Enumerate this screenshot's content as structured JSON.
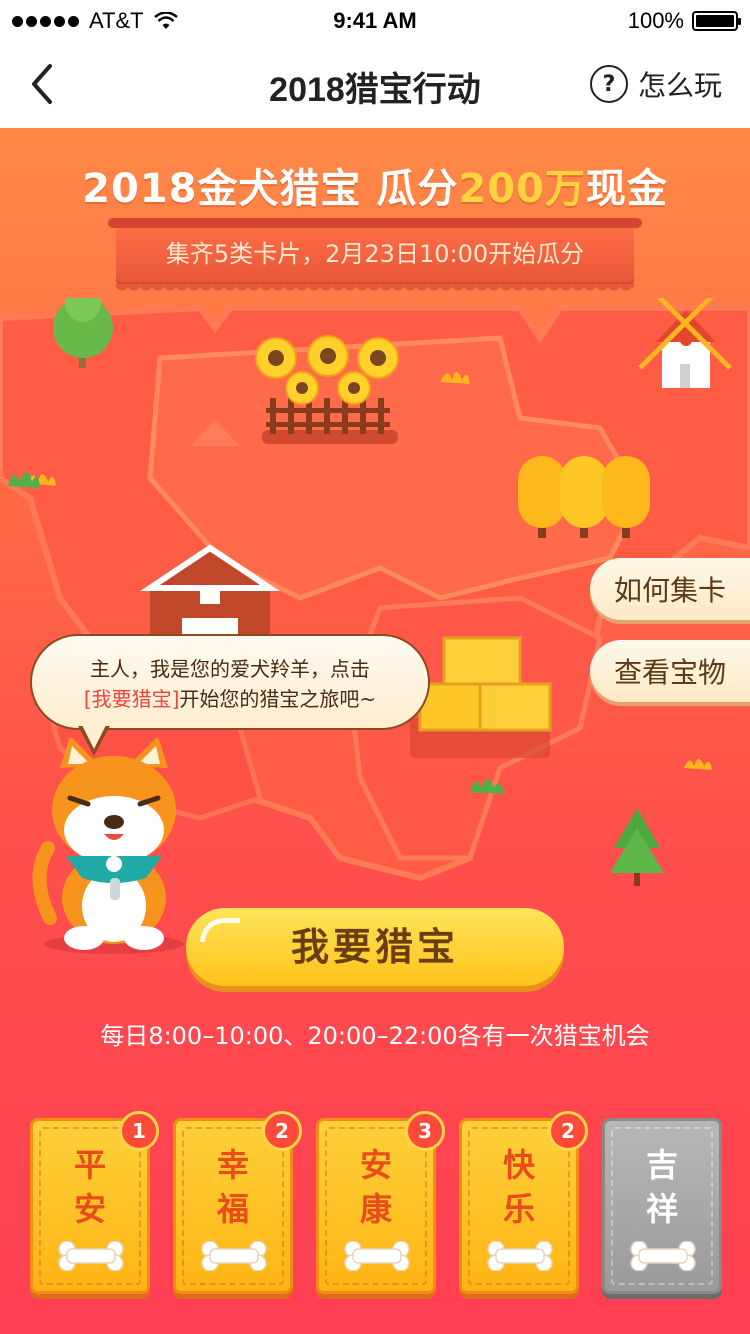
{
  "status_bar": {
    "carrier": "AT&T",
    "time": "9:41 AM",
    "battery": "100%"
  },
  "nav": {
    "title": "2018猎宝行动",
    "help_label": "怎么玩",
    "help_glyph": "?"
  },
  "headline": {
    "part1": "2018金犬猎宝 瓜分",
    "highlight": "200万",
    "part2": "现金"
  },
  "ribbon_text": "集齐5类卡片，2月23日10:00开始瓜分",
  "side_buttons": {
    "collect": "如何集卡",
    "treasure": "查看宝物"
  },
  "bubble": {
    "line1": "主人，我是您的爱犬羚羊，点击",
    "link": "[我要猎宝]",
    "line2": "开始您的猎宝之旅吧~"
  },
  "cta_label": "我要猎宝",
  "schedule_text": "每日8:00–10:00、20:00–22:00各有一次猎宝机会",
  "cards": [
    {
      "line1": "平",
      "line2": "安",
      "count": "1"
    },
    {
      "line1": "幸",
      "line2": "福",
      "count": "2"
    },
    {
      "line1": "安",
      "line2": "康",
      "count": "3"
    },
    {
      "line1": "快",
      "line2": "乐",
      "count": "2"
    },
    {
      "line1": "吉",
      "line2": "祥",
      "count": ""
    }
  ],
  "colors": {
    "accent": "#ff5a4e",
    "gold": "#ffc21a",
    "highlight": "#ffd23f"
  }
}
